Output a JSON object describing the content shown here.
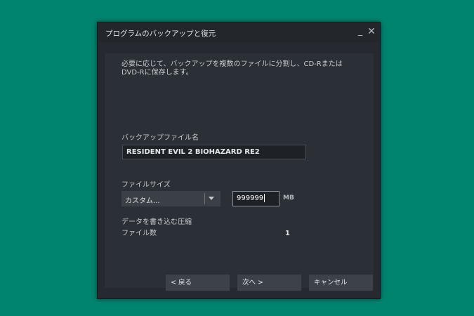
{
  "dialog": {
    "title": "プログラムのバックアップと復元",
    "minimize_glyph": "_",
    "close_glyph": "✕",
    "description": "必要に応じて、バックアップを複数のファイルに分割し、CD-Rまたは\nDVD-Rに保存します。",
    "backup_name_label": "バックアップファイル名",
    "backup_name_value": "RESIDENT EVIL 2  BIOHAZARD RE2",
    "file_size_label": "ファイルサイズ",
    "file_size_option": "カスタム...",
    "file_size_value": "999999",
    "file_size_unit": "MB",
    "compress_label": "データを書き込む圧縮",
    "file_count_label": "ファイル数",
    "file_count_value": "1",
    "buttons": {
      "back": "< 戻る",
      "next": "次へ >",
      "cancel": "キャンセル"
    }
  },
  "colors": {
    "desktop": "#00846f",
    "dialog_bg": "#262a30",
    "panel_bg": "#2b2f36",
    "button_bg": "#3d424a"
  },
  "icons": {
    "minimize": "minimize-icon",
    "close": "close-icon",
    "dropdown": "chevron-down-icon"
  }
}
